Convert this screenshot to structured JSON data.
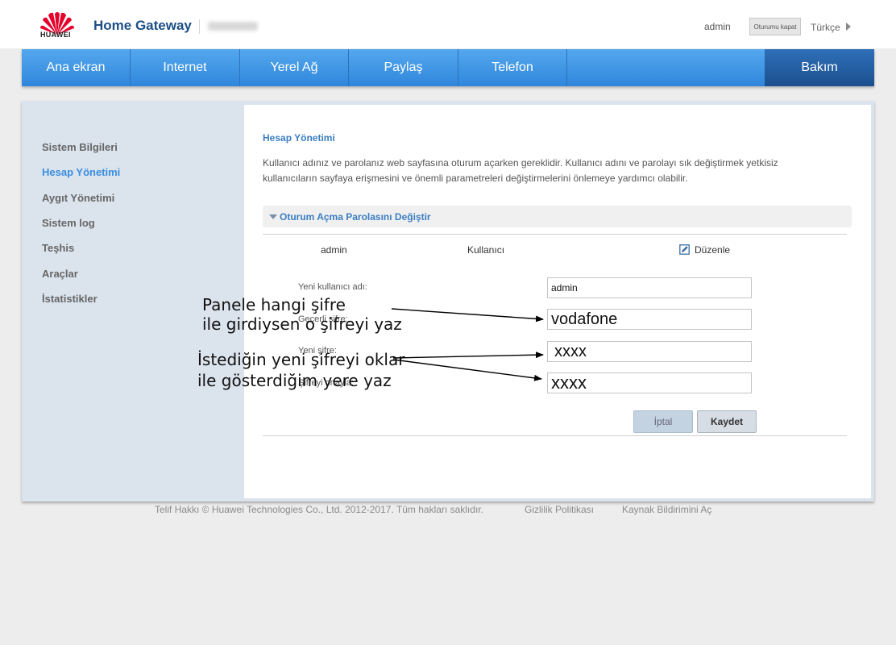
{
  "header": {
    "brand": "HUAWEI",
    "app_title": "Home Gateway",
    "username": "admin",
    "logout_label": "Oturumu kapat",
    "language": "Türkçe"
  },
  "nav": {
    "items": [
      "Ana ekran",
      "Internet",
      "Yerel Ağ",
      "Paylaş",
      "Telefon",
      "Bakım"
    ],
    "active": "Bakım"
  },
  "sidebar": {
    "items": [
      "Sistem Bilgileri",
      "Hesap Yönetimi",
      "Aygıt Yönetimi",
      "Sistem log",
      "Teşhis",
      "Araçlar",
      "İstatistikler"
    ],
    "active": "Hesap Yönetimi"
  },
  "main": {
    "title": "Hesap Yönetimi",
    "description": "Kullanıcı adınız ve parolanız web sayfasına oturum açarken gereklidir. Kullanıcı adını ve parolayı sık değiştirmek yetkisiz kullanıcıların sayfaya erişmesini ve önemli parametreleri değiştirmelerini önlemeye yardımcı olabilir.",
    "section_title": "Oturum Açma Parolasını Değiştir",
    "account_row": {
      "username": "admin",
      "role": "Kullanıcı",
      "edit_label": "Düzenle"
    },
    "form": {
      "new_username_label": "Yeni kullanıcı adı:",
      "new_username_value": "admin",
      "current_password_label": "Geçerli şifre:",
      "current_password_value": "vodafone",
      "new_password_label": "Yeni şifre:",
      "new_password_value": "xxxx",
      "confirm_password_label": "Şifreyi onayla:",
      "confirm_password_value": "xxxx"
    },
    "cancel_label": "İptal",
    "save_label": "Kaydet"
  },
  "footer": {
    "copyright": "Telif Hakkı © Huawei Technologies Co., Ltd. 2012-2017. Tüm hakları saklıdır.",
    "privacy": "Gizlilik Politikası",
    "open_source": "Kaynak Bildirimini Aç"
  },
  "annotations": {
    "note1_line1": "Panele hangi şifre",
    "note1_line2": "ile girdiysen o şifreyi yaz",
    "note2_line1": "İstediğin yeni şifreyi oklar",
    "note2_line2": "ile gösterdiğim yere yaz"
  },
  "colors": {
    "brand_red": "#e4002b",
    "nav_blue": "#3b8fe0",
    "nav_active": "#1e5596",
    "link_blue": "#3a7ec2"
  },
  "icons": [
    "huawei-logo-icon",
    "caret-right-icon",
    "triangle-down-icon",
    "edit-icon"
  ]
}
